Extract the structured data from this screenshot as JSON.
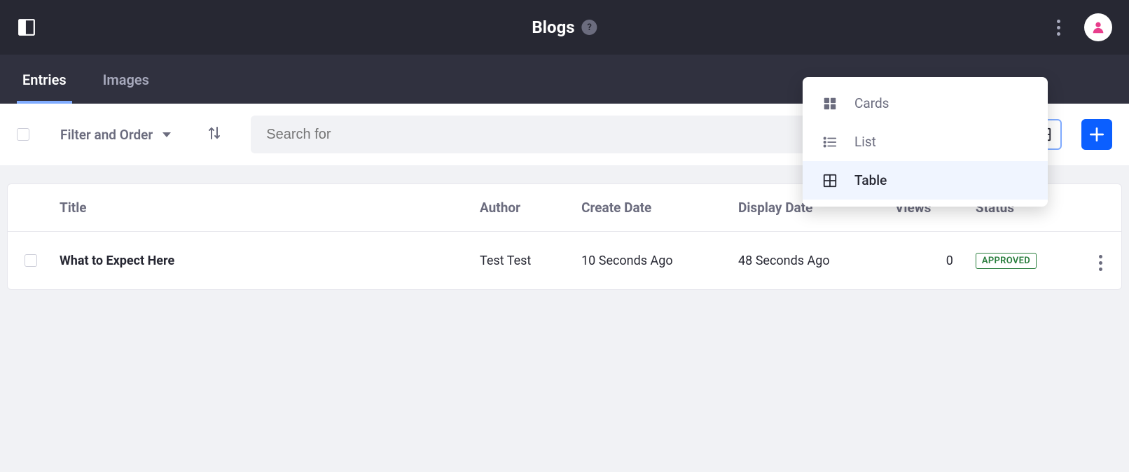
{
  "header": {
    "title": "Blogs",
    "help_label": "?"
  },
  "tabs": [
    {
      "label": "Entries",
      "active": true
    },
    {
      "label": "Images",
      "active": false
    }
  ],
  "toolbar": {
    "filter_label": "Filter and Order",
    "search_placeholder": "Search for"
  },
  "view_menu": {
    "items": [
      {
        "label": "Cards",
        "icon": "cards-icon",
        "active": false
      },
      {
        "label": "List",
        "icon": "list-icon",
        "active": false
      },
      {
        "label": "Table",
        "icon": "table-icon",
        "active": true
      }
    ]
  },
  "table": {
    "columns": {
      "title": "Title",
      "author": "Author",
      "create_date": "Create Date",
      "display_date": "Display Date",
      "views": "Views",
      "status": "Status"
    },
    "rows": [
      {
        "title": "What to Expect Here",
        "author": "Test Test",
        "create_date": "10 Seconds Ago",
        "display_date": "48 Seconds Ago",
        "views": "0",
        "status": "APPROVED"
      }
    ]
  }
}
